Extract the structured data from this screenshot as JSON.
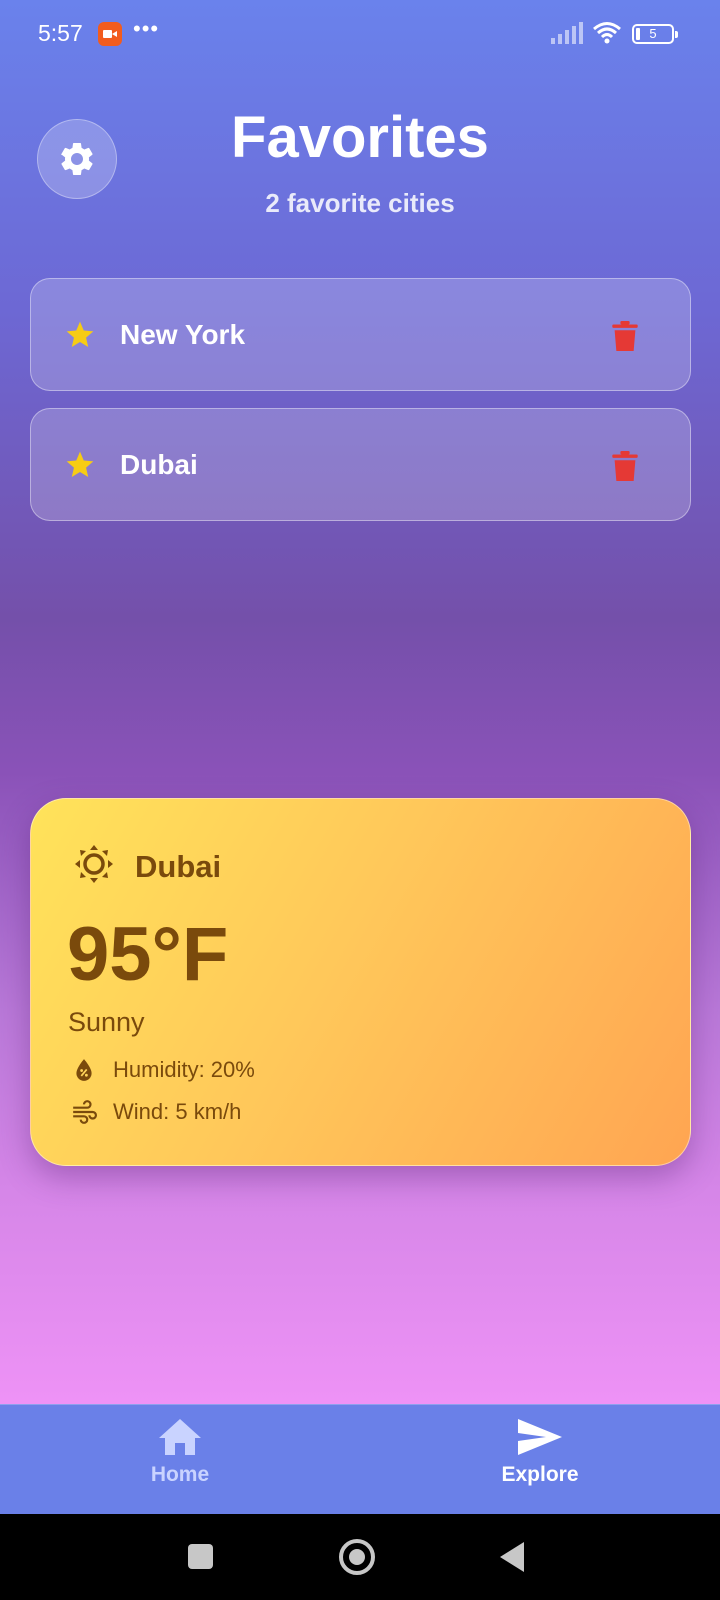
{
  "status_bar": {
    "time": "5:57",
    "more": "•••",
    "battery": "5"
  },
  "header": {
    "title": "Favorites",
    "subtitle": "2 favorite cities",
    "settings_icon": "gear-icon"
  },
  "favorites": [
    {
      "name": "New York",
      "icon": "star-icon",
      "delete_icon": "trash-icon"
    },
    {
      "name": "Dubai",
      "icon": "star-icon",
      "delete_icon": "trash-icon"
    }
  ],
  "weather": {
    "city": "Dubai",
    "icon": "sun-icon",
    "temperature": "95°F",
    "condition": "Sunny",
    "humidity": "Humidity: 20%",
    "wind": "Wind: 5 km/h"
  },
  "nav": {
    "home": "Home",
    "explore": "Explore",
    "active": "explore"
  },
  "colors": {
    "star": "#f7cc14",
    "delete": "#e53935",
    "card_text": "#7a4a0c",
    "nav_bg": "#6a80e8"
  }
}
